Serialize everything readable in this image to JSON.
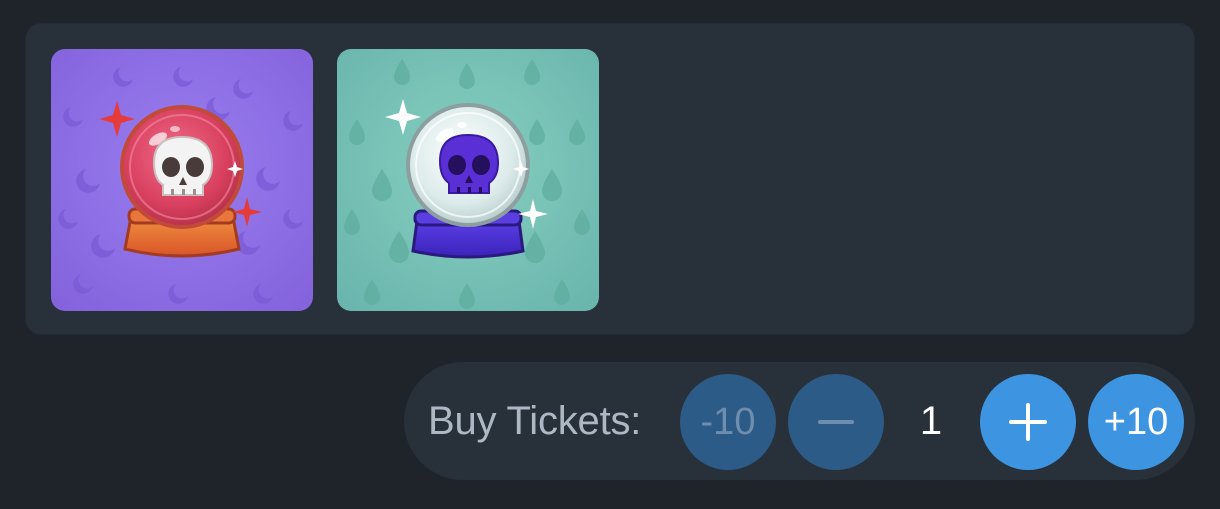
{
  "items": [
    {
      "name": "Red Crystal Ball",
      "icon": "crystal-ball-red-skull-icon",
      "background": "#8b6ce0",
      "pattern_color": "#7a5ad6"
    },
    {
      "name": "Purple Crystal Ball",
      "icon": "crystal-ball-purple-skull-icon",
      "background": "#6fbcb2",
      "pattern_color": "#5fae9f"
    }
  ],
  "buy": {
    "label": "Buy Tickets:",
    "minus10_label": "-10",
    "plus10_label": "+10",
    "quantity": "1",
    "minus_icon": "minus-icon",
    "plus_icon": "plus-icon"
  },
  "colors": {
    "page_bg": "#1f242b",
    "panel_bg": "#28303a",
    "button_active": "#3d94e0",
    "button_disabled": "#2b5b86"
  }
}
